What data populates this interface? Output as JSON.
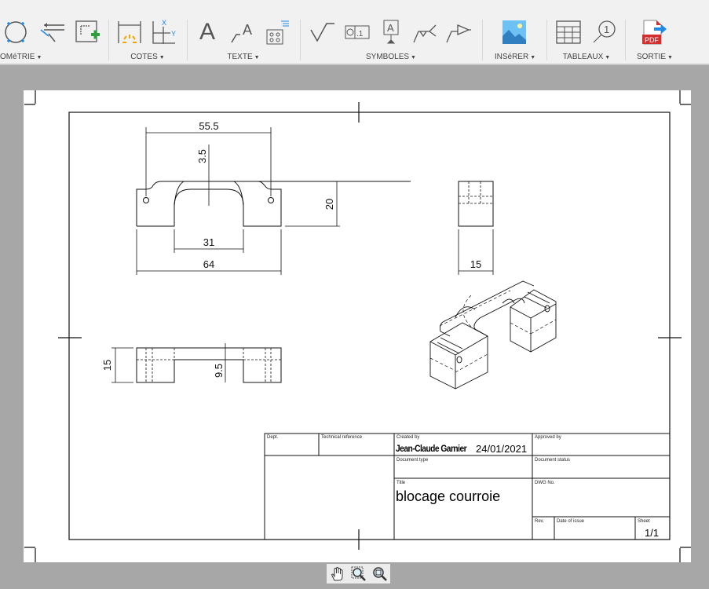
{
  "toolbar": {
    "groups": [
      {
        "label": "OMéTRIE"
      },
      {
        "label": "COTES"
      },
      {
        "label": "TEXTE"
      },
      {
        "label": "SYMBOLES"
      },
      {
        "label": "INSéRER"
      },
      {
        "label": "TABLEAUX"
      },
      {
        "label": "SORTIE"
      }
    ],
    "pdf_label": "PDF",
    "balloon_label": "1",
    "datum_label": "A",
    "text_label": "A",
    "fcf_label": ".1",
    "xy_x": "X",
    "xy_y": "Y"
  },
  "drawing": {
    "dims": {
      "d55_5": "55.5",
      "d3_5": "3.5",
      "d20": "20",
      "d31": "31",
      "d64": "64",
      "d15_side": "15",
      "d15_top": "15",
      "d9_5": "9.5"
    }
  },
  "title_block": {
    "dept_label": "Dept.",
    "tech_ref_label": "Technical reference",
    "created_by_label": "Created by",
    "created_by": "Jean-Claude Garnier",
    "date": "24/01/2021",
    "approved_by_label": "Approved by",
    "doc_type_label": "Document type",
    "doc_status_label": "Document status",
    "title_label": "Title",
    "title": "blocage courroie",
    "dwg_label": "DWG No.",
    "rev_label": "Rev.",
    "date_issue_label": "Date of issue",
    "sheet_label": "Sheet",
    "sheet": "1/1"
  },
  "colors": {
    "accent_blue": "#1e88e5",
    "pdf_red": "#d32f2f",
    "green_plus": "#2e9e3e",
    "orange": "#f2a400"
  }
}
